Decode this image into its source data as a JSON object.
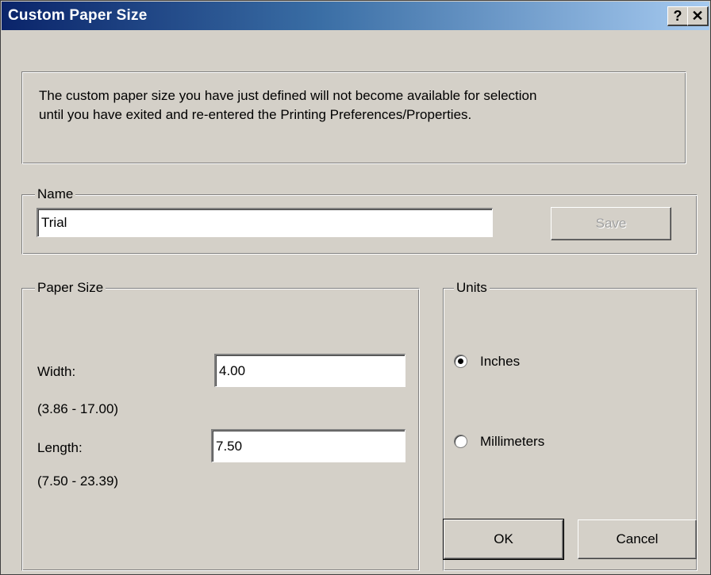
{
  "window": {
    "title": "Custom Paper Size",
    "help_glyph": "?",
    "close_glyph": "✕"
  },
  "notice": {
    "line1": "The custom paper size you have just defined will not become available for selection",
    "line2": "until you have exited and re-entered the Printing Preferences/Properties."
  },
  "name_group": {
    "legend": "Name",
    "value": "Trial",
    "save_label": "Save"
  },
  "paper_size": {
    "legend": "Paper Size",
    "width_label": "Width:",
    "width_value": "4.00",
    "width_range": "(3.86 - 17.00)",
    "length_label": "Length:",
    "length_value": "7.50",
    "length_range": "(7.50 - 23.39)"
  },
  "units": {
    "legend": "Units",
    "inches_label": "Inches",
    "millimeters_label": "Millimeters",
    "selected": "Inches"
  },
  "footer": {
    "ok_label": "OK",
    "cancel_label": "Cancel"
  }
}
